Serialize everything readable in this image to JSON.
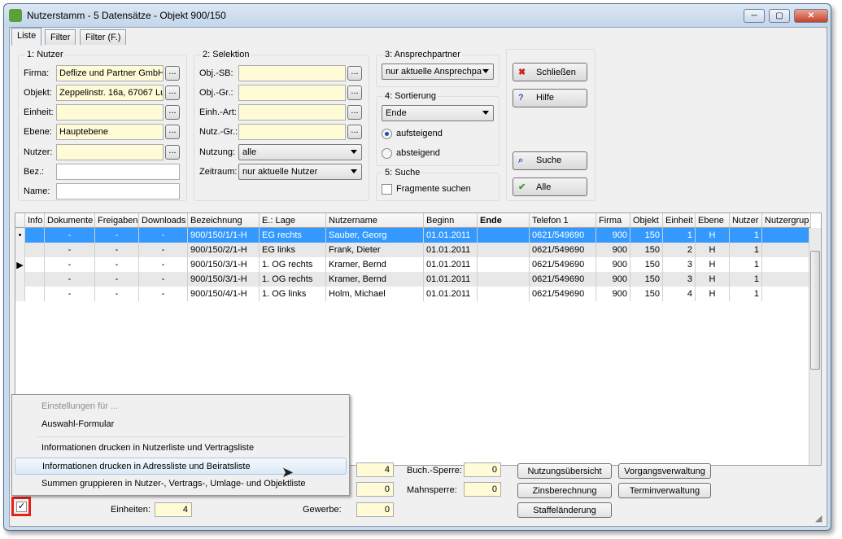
{
  "window": {
    "title": "Nutzerstamm - 5 Datensätze - Objekt 900/150",
    "min": "─",
    "max": "▢",
    "close": "✕"
  },
  "tabs": [
    "Liste",
    "Filter",
    "Filter (F.)"
  ],
  "nutzer": {
    "title": "1: Nutzer",
    "firma_label": "Firma:",
    "firma_value": "Deflize und Partner GmbH",
    "objekt_label": "Objekt:",
    "objekt_value": "Zeppelinstr. 16a, 67067 Lu",
    "einheit_label": "Einheit:",
    "einheit_value": "",
    "ebene_label": "Ebene:",
    "ebene_value": "Hauptebene",
    "nutzer_label": "Nutzer:",
    "nutzer_value": "",
    "bez_label": "Bez.:",
    "bez_value": "",
    "name_label": "Name:",
    "name_value": ""
  },
  "selektion": {
    "title": "2: Selektion",
    "objsb_label": "Obj.-SB:",
    "objgr_label": "Obj.-Gr.:",
    "einhart_label": "Einh.-Art:",
    "nutzgr_label": "Nutz.-Gr.:",
    "nutzung_label": "Nutzung:",
    "nutzung_value": "alle",
    "zeitraum_label": "Zeitraum:",
    "zeitraum_value": "nur aktuelle Nutzer"
  },
  "ansprech": {
    "title": "3: Ansprechpartner",
    "value": "nur aktuelle Ansprechpa"
  },
  "sortierung": {
    "title": "4: Sortierung",
    "value": "Ende",
    "asc": "aufsteigend",
    "desc": "absteigend"
  },
  "suche": {
    "title": "5: Suche",
    "fragmente": "Fragmente suchen"
  },
  "buttons": {
    "schliessen": "Schließen",
    "hilfe": "Hilfe",
    "suche": "Suche",
    "alle": "Alle",
    "dots": "..."
  },
  "grid": {
    "headers": [
      "Info",
      "Dokumente",
      "Freigaben",
      "Downloads",
      "Bezeichnung",
      "E.: Lage",
      "Nutzername",
      "Beginn",
      "Ende",
      "Telefon 1",
      "Firma",
      "Objekt",
      "Einheit",
      "Ebene",
      "Nutzer",
      "Nutzergrup"
    ],
    "rows": [
      {
        "marker": "•",
        "cells": [
          "",
          "-",
          "-",
          "-",
          "900/150/1/1-H",
          "EG rechts",
          "Sauber, Georg",
          "01.01.2011",
          "",
          "0621/549690",
          "900",
          "150",
          "1",
          "H",
          "1",
          ""
        ]
      },
      {
        "marker": "",
        "cells": [
          "",
          "-",
          "-",
          "-",
          "900/150/2/1-H",
          "EG links",
          "Frank, Dieter",
          "01.01.2011",
          "",
          "0621/549690",
          "900",
          "150",
          "2",
          "H",
          "1",
          ""
        ]
      },
      {
        "marker": "▶",
        "cells": [
          "",
          "-",
          "-",
          "-",
          "900/150/3/1-H",
          "1. OG rechts",
          "Kramer, Bernd",
          "01.01.2011",
          "",
          "0621/549690",
          "900",
          "150",
          "3",
          "H",
          "1",
          ""
        ]
      },
      {
        "marker": "",
        "cells": [
          "",
          "-",
          "-",
          "-",
          "900/150/3/1-H",
          "1. OG rechts",
          "Kramer, Bernd",
          "01.01.2011",
          "",
          "0621/549690",
          "900",
          "150",
          "3",
          "H",
          "1",
          ""
        ]
      },
      {
        "marker": "",
        "cells": [
          "",
          "-",
          "-",
          "-",
          "900/150/4/1-H",
          "1. OG links",
          "Holm, Michael",
          "01.01.2011",
          "",
          "0621/549690",
          "900",
          "150",
          "4",
          "H",
          "1",
          ""
        ]
      }
    ]
  },
  "summary": {
    "einheiten_label": "Einheiten:",
    "einheiten_value": "4",
    "val_a": "4",
    "val_b": "0",
    "gewerbe_label": "Gewerbe:",
    "gewerbe_value": "0",
    "buchsperre_label": "Buch.-Sperre:",
    "buchsperre_value": "0",
    "mahnsperre_label": "Mahnsperre:",
    "mahnsperre_value": "0"
  },
  "actions": {
    "nutzungsuebersicht": "Nutzungsübersicht",
    "vorgangsverwaltung": "Vorgangsverwaltung",
    "zinsberechnung": "Zinsberechnung",
    "terminverwaltung": "Terminverwaltung",
    "staffelaenderung": "Staffeländerung"
  },
  "context_menu": {
    "items": [
      "Einstellungen für ...",
      "Auswahl-Formular",
      "Informationen drucken in Nutzerliste und Vertragsliste",
      "Informationen drucken in Adressliste und Beiratsliste",
      "Summen gruppieren in Nutzer-, Vertrags-, Umlage- und Objektliste"
    ]
  },
  "checkbox": {
    "mark": "✓"
  },
  "colors": {
    "selection": "#3399ff",
    "highlight_box": "#e8201c",
    "field_yellow": "#fffbd6"
  }
}
